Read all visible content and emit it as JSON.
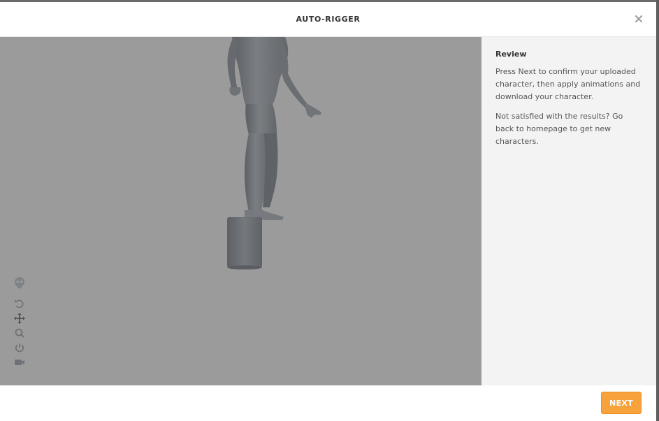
{
  "header": {
    "title": "AUTO-RIGGER",
    "close_icon": "close-icon"
  },
  "viewport": {
    "tools": [
      {
        "name": "skeleton-icon",
        "interactable": true
      },
      {
        "name": "undo-icon",
        "interactable": true
      },
      {
        "name": "move-icon",
        "interactable": true
      },
      {
        "name": "zoom-icon",
        "interactable": true
      },
      {
        "name": "power-icon",
        "interactable": true
      },
      {
        "name": "camera-icon",
        "interactable": true
      }
    ]
  },
  "panel": {
    "heading": "Review",
    "paragraph_1": "Press Next to confirm your uploaded character, then apply animations and download your character.",
    "paragraph_2": "Not satisfied with the results? Go back to homepage to get new characters."
  },
  "footer": {
    "next_label": "NEXT"
  },
  "colors": {
    "accent": "#f7a23a",
    "viewport_bg": "#9b9b9b",
    "panel_bg": "#f3f3f3"
  }
}
